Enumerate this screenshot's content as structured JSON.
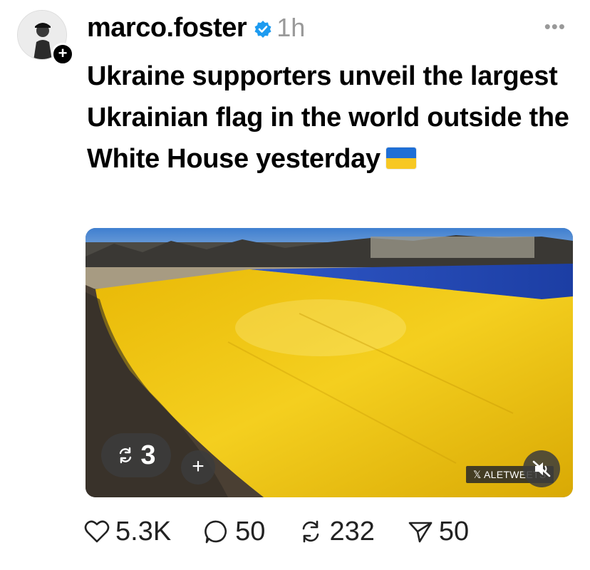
{
  "post": {
    "username": "marco.foster",
    "timestamp": "1h",
    "more_label": "•••",
    "text": "Ukraine supporters unveil the largest Ukrainian flag in the world outside the White House yesterday",
    "follow_badge": "+",
    "verified_icon": "verified-badge-icon",
    "flag_emoji": "ukraine-flag-emoji"
  },
  "media": {
    "repost_count": "3",
    "add_label": "+",
    "watermark": "𝕏 ALETWEETS",
    "mute_icon": "speaker-muted-icon"
  },
  "actions": {
    "likes": "5.3K",
    "replies": "50",
    "reposts": "232",
    "shares": "50"
  },
  "colors": {
    "verified_blue": "#1d9bf0",
    "flag_blue": "#1f6fd6",
    "flag_yellow": "#f7c823",
    "timestamp_gray": "#999999"
  }
}
